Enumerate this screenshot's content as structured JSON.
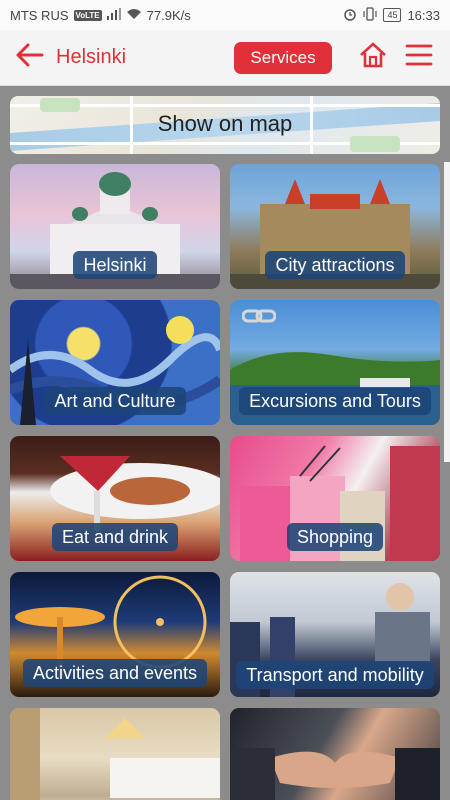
{
  "status_bar": {
    "carrier": "MTS RUS",
    "volte": "VoLTE",
    "speed": "77.9K/s",
    "battery": "45",
    "time": "16:33"
  },
  "header": {
    "title": "Helsinki",
    "services_label": "Services",
    "accent_color": "#e0313a"
  },
  "map_banner": {
    "label": "Show on map"
  },
  "tiles": [
    {
      "label": "Helsinki"
    },
    {
      "label": "City attractions"
    },
    {
      "label": "Art and Culture"
    },
    {
      "label": "Excursions and Tours"
    },
    {
      "label": "Eat and drink"
    },
    {
      "label": "Shopping"
    },
    {
      "label": "Activities and events"
    },
    {
      "label": "Transport and mobility"
    }
  ],
  "icons": {
    "back": "arrow-left-icon",
    "home": "home-icon",
    "menu": "hamburger-menu-icon",
    "link": "link-icon"
  }
}
